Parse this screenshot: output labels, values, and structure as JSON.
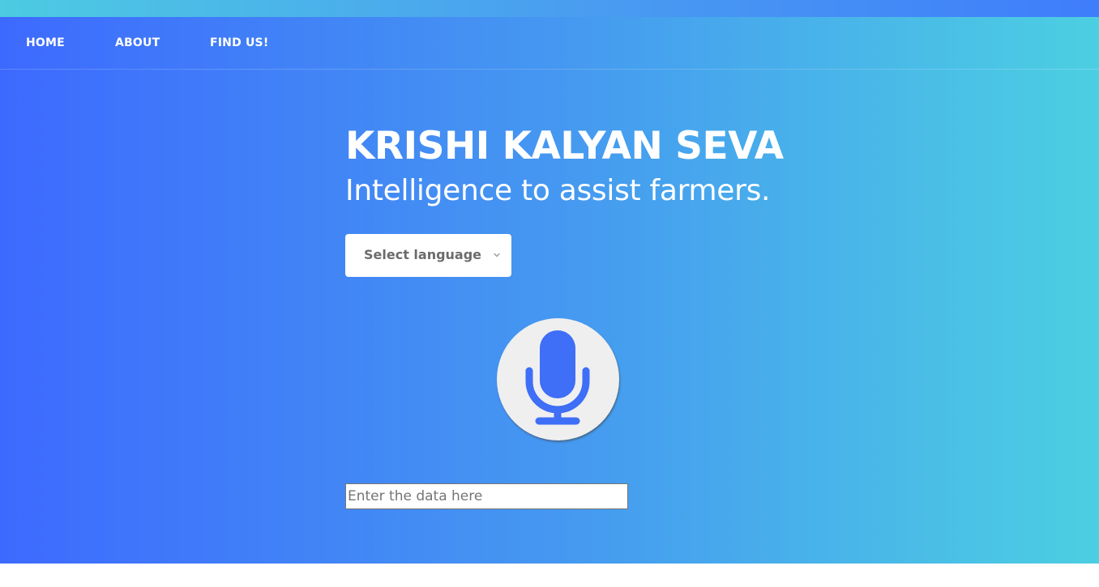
{
  "nav": {
    "home": "HOME",
    "about": "ABOUT",
    "find": "FIND US!"
  },
  "hero": {
    "title": "KRISHI KALYAN SEVA",
    "subtitle": "Intelligence to assist farmers."
  },
  "language_select": {
    "selected": "Select language",
    "icon": "chevron-down-icon"
  },
  "mic": {
    "icon": "microphone-icon",
    "color": "#3f6ef7"
  },
  "data_input": {
    "value": "",
    "placeholder": "Enter the data here"
  },
  "colors": {
    "gradient_left": "#3d6afe",
    "gradient_right": "#4ccfe2",
    "text": "#ffffff"
  }
}
